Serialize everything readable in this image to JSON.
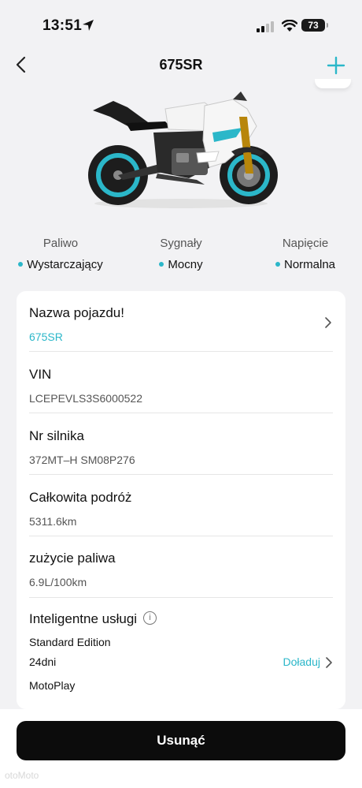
{
  "status_bar": {
    "time": "13:51",
    "battery": "73"
  },
  "header": {
    "title": "675SR"
  },
  "stats": [
    {
      "label": "Paliwo",
      "value": "Wystarczający"
    },
    {
      "label": "Sygnały",
      "value": "Mocny"
    },
    {
      "label": "Napięcie",
      "value": "Normalna"
    }
  ],
  "details": {
    "name": {
      "label": "Nazwa pojazdu!",
      "value": "675SR"
    },
    "vin": {
      "label": "VIN",
      "value": "LCEPEVLS3S6000522"
    },
    "engine": {
      "label": "Nr silnika",
      "value": "372MT–H SM08P276"
    },
    "mileage": {
      "label": "Całkowita podróż",
      "value": "5311.6km"
    },
    "fuel": {
      "label": "zużycie paliwa",
      "value": "6.9L/100km"
    },
    "services": {
      "label": "Inteligentne usługi",
      "edition": "Standard Edition",
      "days": "24dni",
      "topup": "Doładuj",
      "motoplay": "MotoPlay"
    }
  },
  "actions": {
    "delete": "Usunąć"
  },
  "watermark": "otoMoto",
  "colors": {
    "accent": "#2bb7c9",
    "button": "#0c0c0c",
    "background": "#f2f2f4"
  }
}
